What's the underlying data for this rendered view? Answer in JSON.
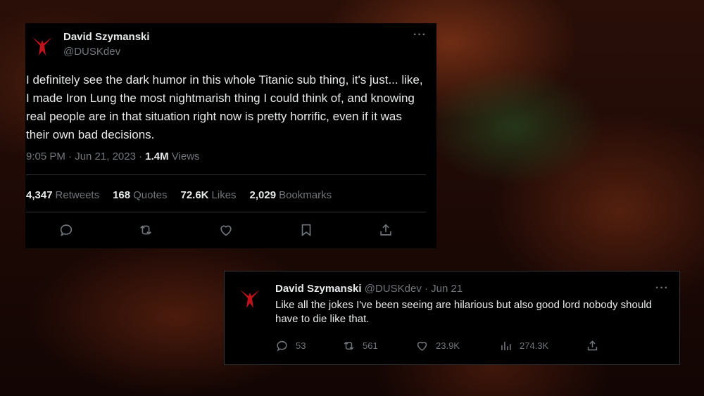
{
  "main_tweet": {
    "name": "David Szymanski",
    "handle": "@DUSKdev",
    "text": "I definitely see the dark humor in this whole Titanic sub thing, it's just... like, I made Iron Lung the most nightmarish thing I could think of, and knowing real people are in that situation right now is pretty horrific, even if it was their own bad decisions.",
    "time": "9:05 PM · Jun 21, 2023 · ",
    "views_count": "1.4M",
    "views_label": " Views",
    "retweets_count": "4,347",
    "retweets_label": "Retweets",
    "quotes_count": "168",
    "quotes_label": "Quotes",
    "likes_count": "72.6K",
    "likes_label": "Likes",
    "bookmarks_count": "2,029",
    "bookmarks_label": "Bookmarks",
    "more": "···"
  },
  "reply_tweet": {
    "name": "David Szymanski",
    "handle_date": " @DUSKdev · Jun 21",
    "text": "Like all the jokes I've been seeing are hilarious but also good lord nobody should have to die like that.",
    "replies": "53",
    "retweets": "561",
    "likes": "23.9K",
    "views": "274.3K",
    "more": "···"
  },
  "colors": {
    "card_bg": "#000000",
    "text_primary": "#e7e9ea",
    "text_secondary": "#71767b",
    "avatar_red": "#c0121a"
  },
  "icons": [
    "avatar-logo-icon",
    "more-icon",
    "reply-icon",
    "retweet-icon",
    "like-icon",
    "bookmark-icon",
    "share-icon",
    "views-icon"
  ]
}
